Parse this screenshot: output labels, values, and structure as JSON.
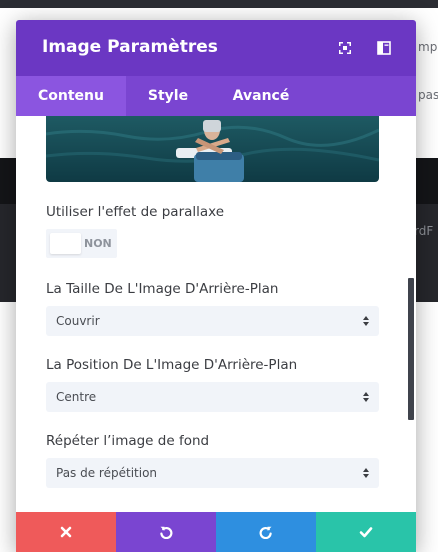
{
  "background": {
    "text_1": "mp",
    "text_2": "pas",
    "text_3": "rdF"
  },
  "modal": {
    "title": "Image Paramètres",
    "header_icons": [
      "expand-icon",
      "split-view-icon"
    ],
    "accent_color": "#6b37c3"
  },
  "tabs": [
    {
      "label": "Contenu",
      "active": true
    },
    {
      "label": "Style",
      "active": false
    },
    {
      "label": "Avancé",
      "active": false
    }
  ],
  "fields": {
    "parallax": {
      "label": "Utiliser l'effet de parallaxe",
      "value": "NON"
    },
    "bg_size": {
      "label": "La Taille De L'Image D'Arrière-Plan",
      "value": "Couvrir"
    },
    "bg_position": {
      "label": "La Position De L'Image D'Arrière-Plan",
      "value": "Centre"
    },
    "bg_repeat": {
      "label": "Répéter l’image de fond",
      "value": "Pas de répétition"
    }
  },
  "footer": {
    "buttons": [
      {
        "name": "cancel",
        "icon": "close-icon",
        "color": "#ef5a5a"
      },
      {
        "name": "undo",
        "icon": "undo-icon",
        "color": "#7a45d1"
      },
      {
        "name": "redo",
        "icon": "redo-icon",
        "color": "#2e8fe0"
      },
      {
        "name": "save",
        "icon": "check-icon",
        "color": "#29c4a9"
      }
    ]
  }
}
